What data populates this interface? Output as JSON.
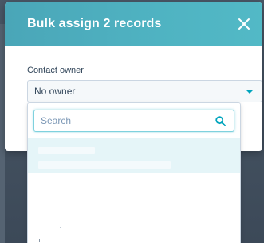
{
  "modal": {
    "title": "Bulk assign 2 records",
    "close_icon": "close-icon"
  },
  "contact_owner": {
    "label": "Contact owner",
    "value": "No owner"
  },
  "dropdown": {
    "search_placeholder": "Search",
    "search_value": "",
    "search_icon": "search-icon"
  },
  "colors": {
    "header_gradient_start": "#4aa6b8",
    "header_gradient_end": "#52b9c6",
    "accent": "#00a4bd",
    "selected_option_bg": "#e5f5f8",
    "text": "#33475b"
  }
}
